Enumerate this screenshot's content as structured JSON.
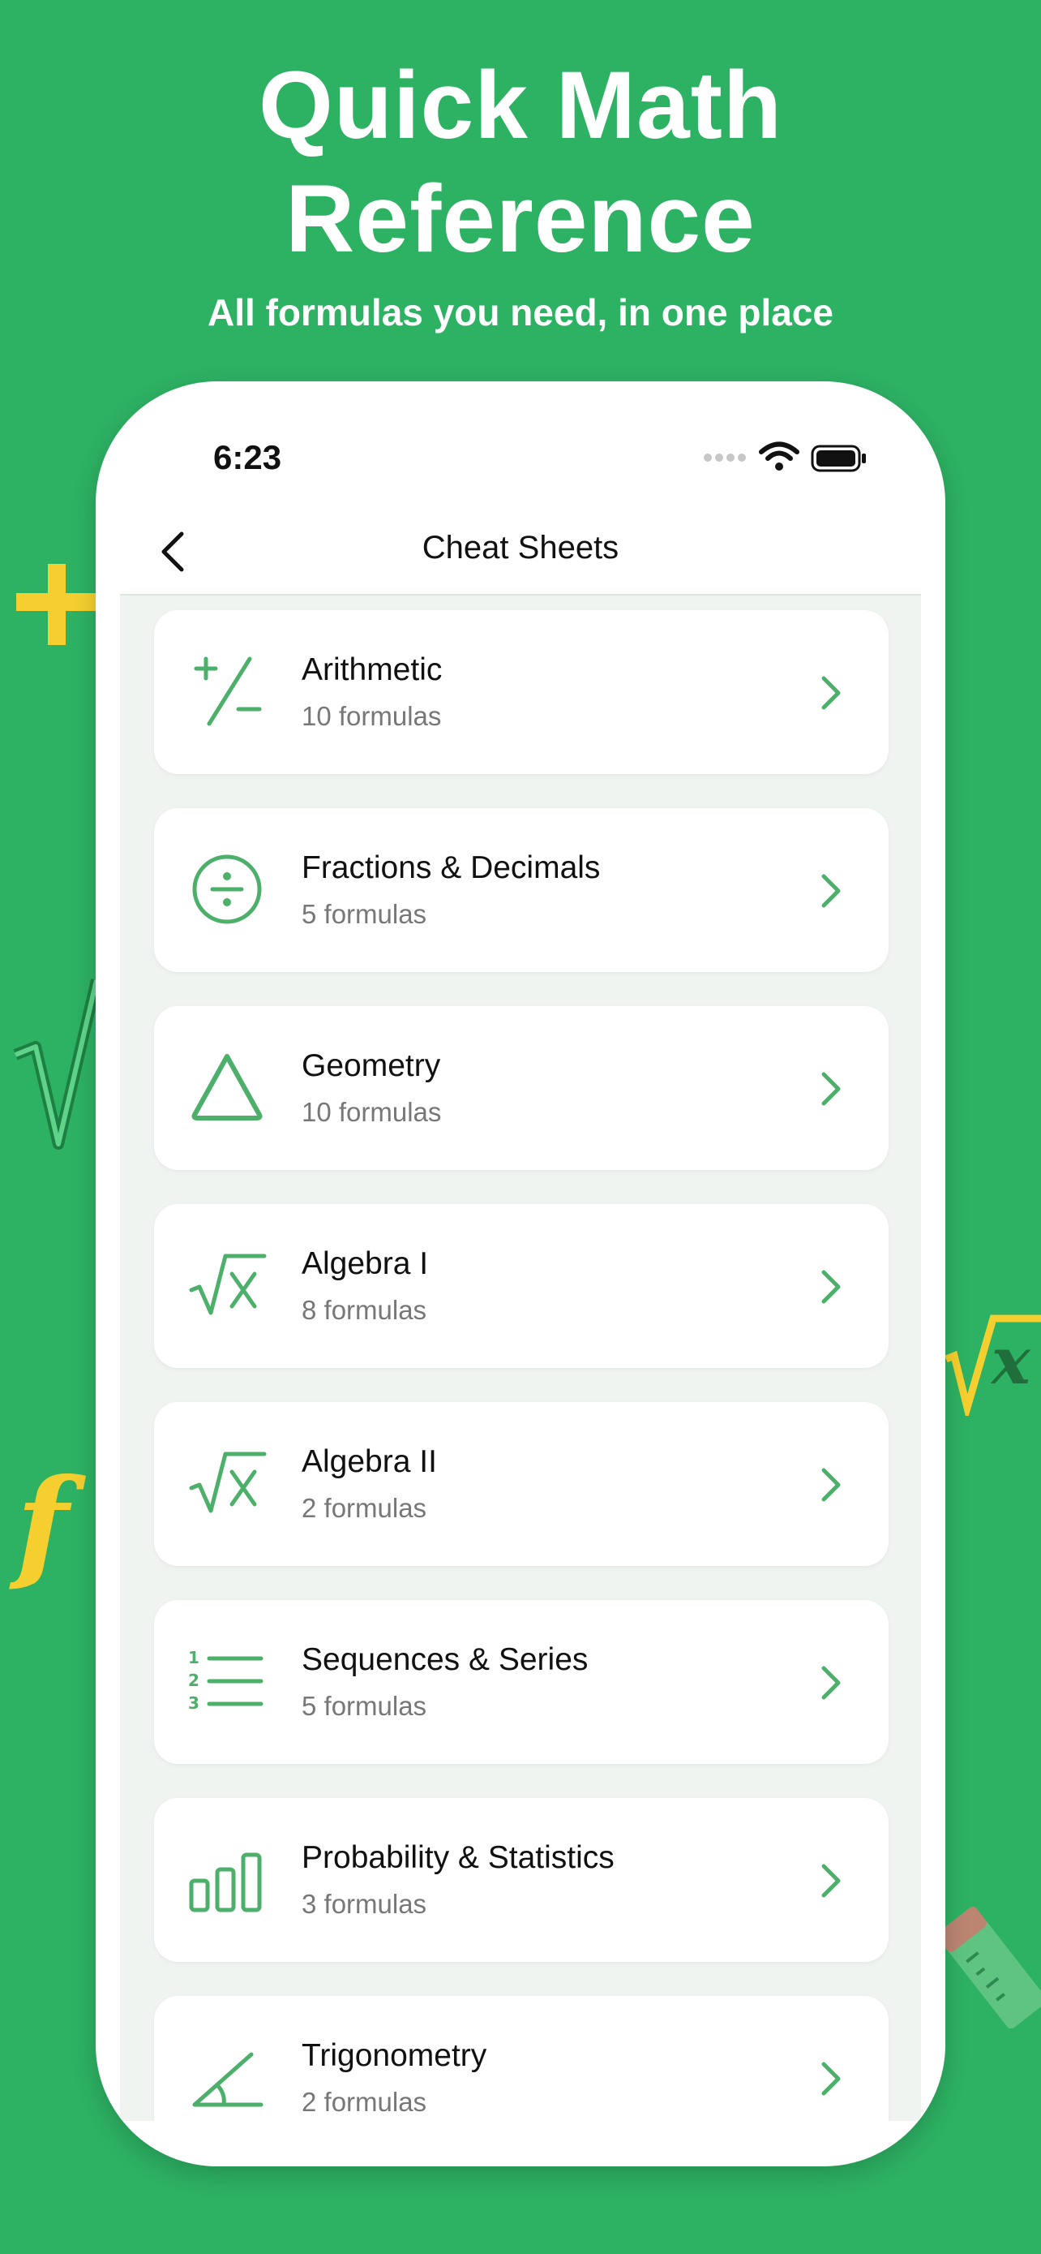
{
  "header": {
    "title_line1": "Quick Math",
    "title_line2": "Reference",
    "subtitle": "All formulas you need, in one place"
  },
  "status_bar": {
    "time": "6:23"
  },
  "nav": {
    "title": "Cheat Sheets",
    "back_icon": "chevron-left-icon"
  },
  "categories": [
    {
      "title": "Arithmetic",
      "count": "10 formulas",
      "icon": "plus-minus-icon"
    },
    {
      "title": "Fractions & Decimals",
      "count": "5 formulas",
      "icon": "divide-icon"
    },
    {
      "title": "Geometry",
      "count": "10 formulas",
      "icon": "triangle-icon"
    },
    {
      "title": "Algebra I",
      "count": "8 formulas",
      "icon": "sqrt-x-icon"
    },
    {
      "title": "Algebra II",
      "count": "2 formulas",
      "icon": "sqrt-x-icon"
    },
    {
      "title": "Sequences & Series",
      "count": "5 formulas",
      "icon": "numbered-list-icon"
    },
    {
      "title": "Probability & Statistics",
      "count": "3 formulas",
      "icon": "bar-chart-icon"
    },
    {
      "title": "Trigonometry",
      "count": "2 formulas",
      "icon": "angle-icon"
    }
  ],
  "colors": {
    "background": "#2db163",
    "icon_green": "#4caf6a",
    "deco_yellow": "#f5cf2f"
  }
}
